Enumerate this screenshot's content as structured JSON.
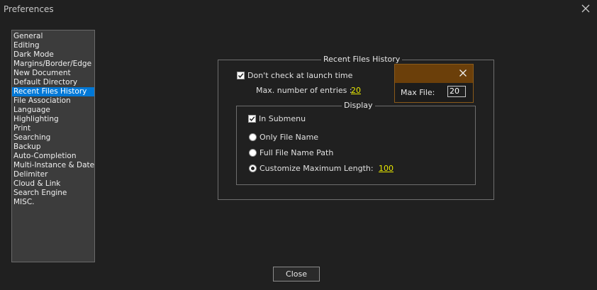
{
  "window": {
    "title": "Preferences"
  },
  "sidebar": {
    "items": [
      {
        "label": "General"
      },
      {
        "label": "Editing"
      },
      {
        "label": "Dark Mode"
      },
      {
        "label": "Margins/Border/Edge"
      },
      {
        "label": "New Document"
      },
      {
        "label": "Default Directory"
      },
      {
        "label": "Recent Files History"
      },
      {
        "label": "File Association"
      },
      {
        "label": "Language"
      },
      {
        "label": "Highlighting"
      },
      {
        "label": "Print"
      },
      {
        "label": "Searching"
      },
      {
        "label": "Backup"
      },
      {
        "label": "Auto-Completion"
      },
      {
        "label": "Multi-Instance & Date"
      },
      {
        "label": "Delimiter"
      },
      {
        "label": "Cloud & Link"
      },
      {
        "label": "Search Engine"
      },
      {
        "label": "MISC."
      }
    ],
    "selected_label": "Recent Files History"
  },
  "recent_files": {
    "group_title": "Recent Files History",
    "dont_check_label": "Don't check at launch time",
    "dont_check_checked": true,
    "max_entries_label": "Max. number of entries :",
    "max_entries_value": "20",
    "display": {
      "group_title": "Display",
      "in_submenu_label": "In Submenu",
      "in_submenu_checked": true,
      "radio_only_name": "Only File Name",
      "radio_full_path": "Full File Name Path",
      "radio_customize": "Customize Maximum Length:",
      "customize_value": "100",
      "selected_radio": "Customize Maximum Length:"
    }
  },
  "popup": {
    "label": "Max File:",
    "value": "20",
    "accent_color": "#6b3f0a"
  },
  "footer": {
    "close_label": "Close"
  },
  "colors": {
    "background": "#202020",
    "selection": "#0078d7",
    "link": "#e8e800"
  }
}
